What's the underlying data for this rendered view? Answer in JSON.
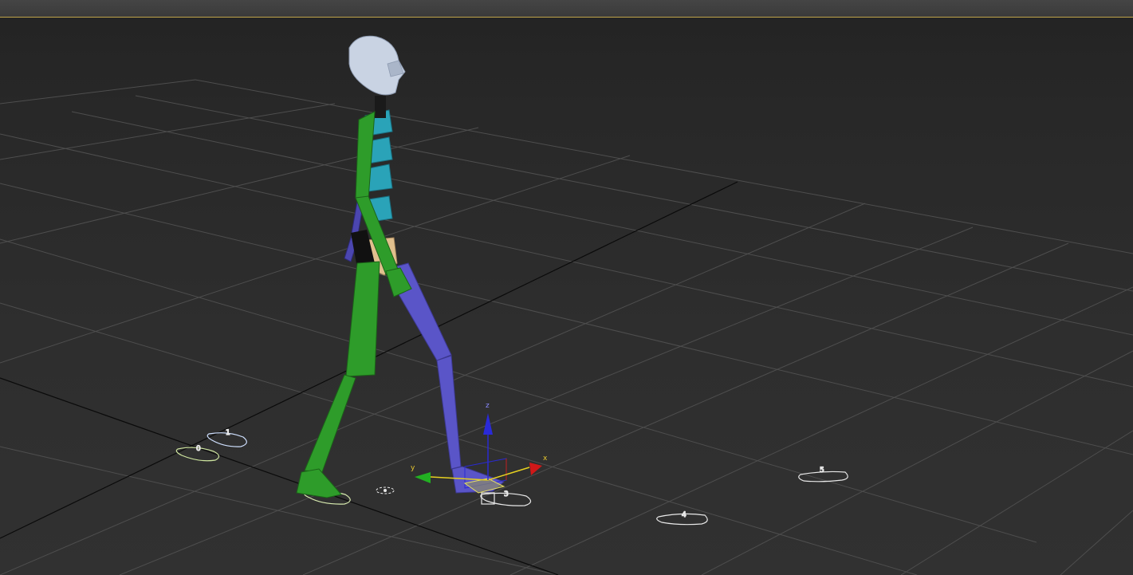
{
  "viewport": {
    "name": "perspective-viewport",
    "colors": {
      "background": "#2d2d2d",
      "grid": "#4e4e4e",
      "grid_axis": "#0a0a0a",
      "active_border": "#bfa34a",
      "biped_left": "#2e9c2a",
      "biped_right": "#5a55c8",
      "spine": "#2aa3b8",
      "head": "#c9d3e3",
      "pelvis": "#e1c08e"
    }
  },
  "footsteps": {
    "labels": [
      "0",
      "1",
      "2",
      "3",
      "4",
      "5"
    ]
  },
  "gizmo": {
    "x_label": "x",
    "y_label": "y",
    "z_label": "z"
  }
}
